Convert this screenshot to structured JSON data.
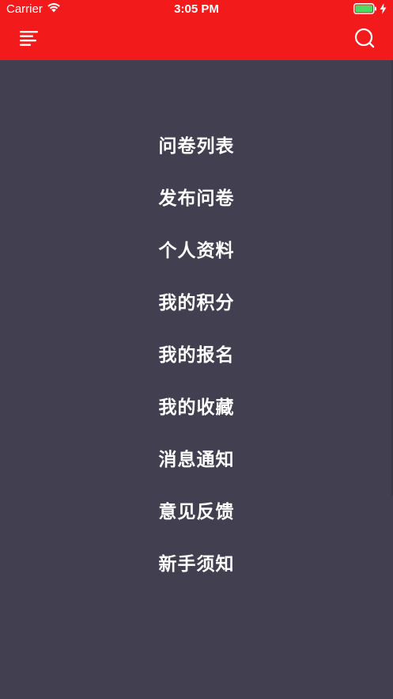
{
  "status_bar": {
    "carrier": "Carrier",
    "time": "3:05 PM"
  },
  "nav": {
    "menu_icon": "hamburger-menu-icon",
    "search_icon": "search-icon"
  },
  "menu": {
    "items": [
      {
        "label": "问卷列表"
      },
      {
        "label": "发布问卷"
      },
      {
        "label": "个人资料"
      },
      {
        "label": "我的积分"
      },
      {
        "label": "我的报名"
      },
      {
        "label": "我的收藏"
      },
      {
        "label": "消息通知"
      },
      {
        "label": "意见反馈"
      },
      {
        "label": "新手须知"
      }
    ]
  },
  "colors": {
    "header": "#f21a1a",
    "background": "#424050",
    "text": "#ffffff"
  }
}
